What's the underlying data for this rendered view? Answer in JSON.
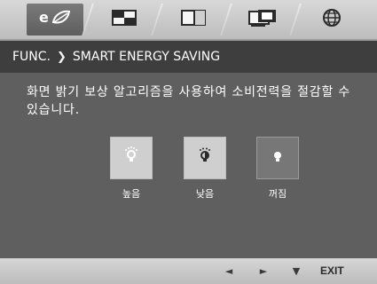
{
  "tabs": [
    {
      "id": "tab-eco",
      "icon": "eco-leaf-icon",
      "active": true
    },
    {
      "id": "tab-picture",
      "icon": "picture-contrast-icon",
      "active": false
    },
    {
      "id": "tab-screen",
      "icon": "screen-split-icon",
      "active": false
    },
    {
      "id": "tab-pip",
      "icon": "pip-window-icon",
      "active": false
    },
    {
      "id": "tab-settings",
      "icon": "globe-icon",
      "active": false
    }
  ],
  "header": {
    "func": "FUNC.",
    "separator": "❯",
    "title": "SMART ENERGY SAVING"
  },
  "description": "화면 밝기 보상 알고리즘을 사용하여 소비전력을 절감할 수 있습니다.",
  "options": [
    {
      "label": "높음",
      "icon": "bulb-high-icon"
    },
    {
      "label": "낮음",
      "icon": "bulb-low-icon"
    },
    {
      "label": "꺼짐",
      "icon": "bulb-off-icon",
      "selected": true
    }
  ],
  "footer": {
    "left_symbol": "◄",
    "right_symbol": "►",
    "down_symbol": "▼",
    "exit_label": "EXIT"
  }
}
